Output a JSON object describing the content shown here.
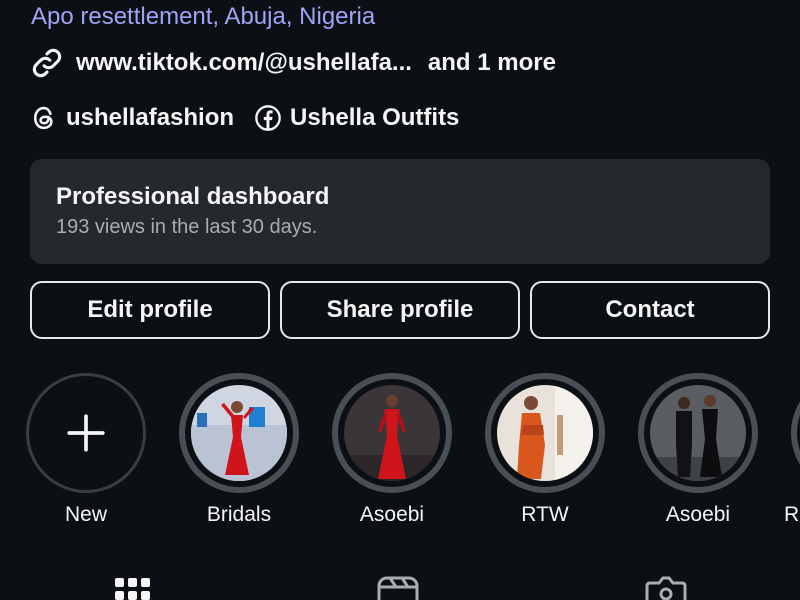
{
  "profile": {
    "location": "Apo resettlement, Abuja, Nigeria",
    "link_text": "www.tiktok.com/@ushellafa...",
    "link_more": "and 1 more",
    "threads_handle": "ushellafashion",
    "facebook_name": "Ushella Outfits"
  },
  "dashboard": {
    "title": "Professional dashboard",
    "subtitle": "193 views in the last 30 days."
  },
  "buttons": {
    "edit": "Edit profile",
    "share": "Share profile",
    "contact": "Contact"
  },
  "highlights": [
    {
      "label": "New",
      "icon": "plus-icon"
    },
    {
      "label": "Bridals"
    },
    {
      "label": "Asoebi"
    },
    {
      "label": "RTW"
    },
    {
      "label": "Asoebi"
    },
    {
      "label": "R"
    }
  ],
  "tabs": [
    {
      "icon": "grid-icon"
    },
    {
      "icon": "reels-icon"
    },
    {
      "icon": "tagged-icon"
    }
  ],
  "colors": {
    "background": "#0c1014",
    "location_link": "#a0a3f7",
    "card": "#25292e",
    "ring": "#4a4f56",
    "dress_red": "#d0141c"
  }
}
